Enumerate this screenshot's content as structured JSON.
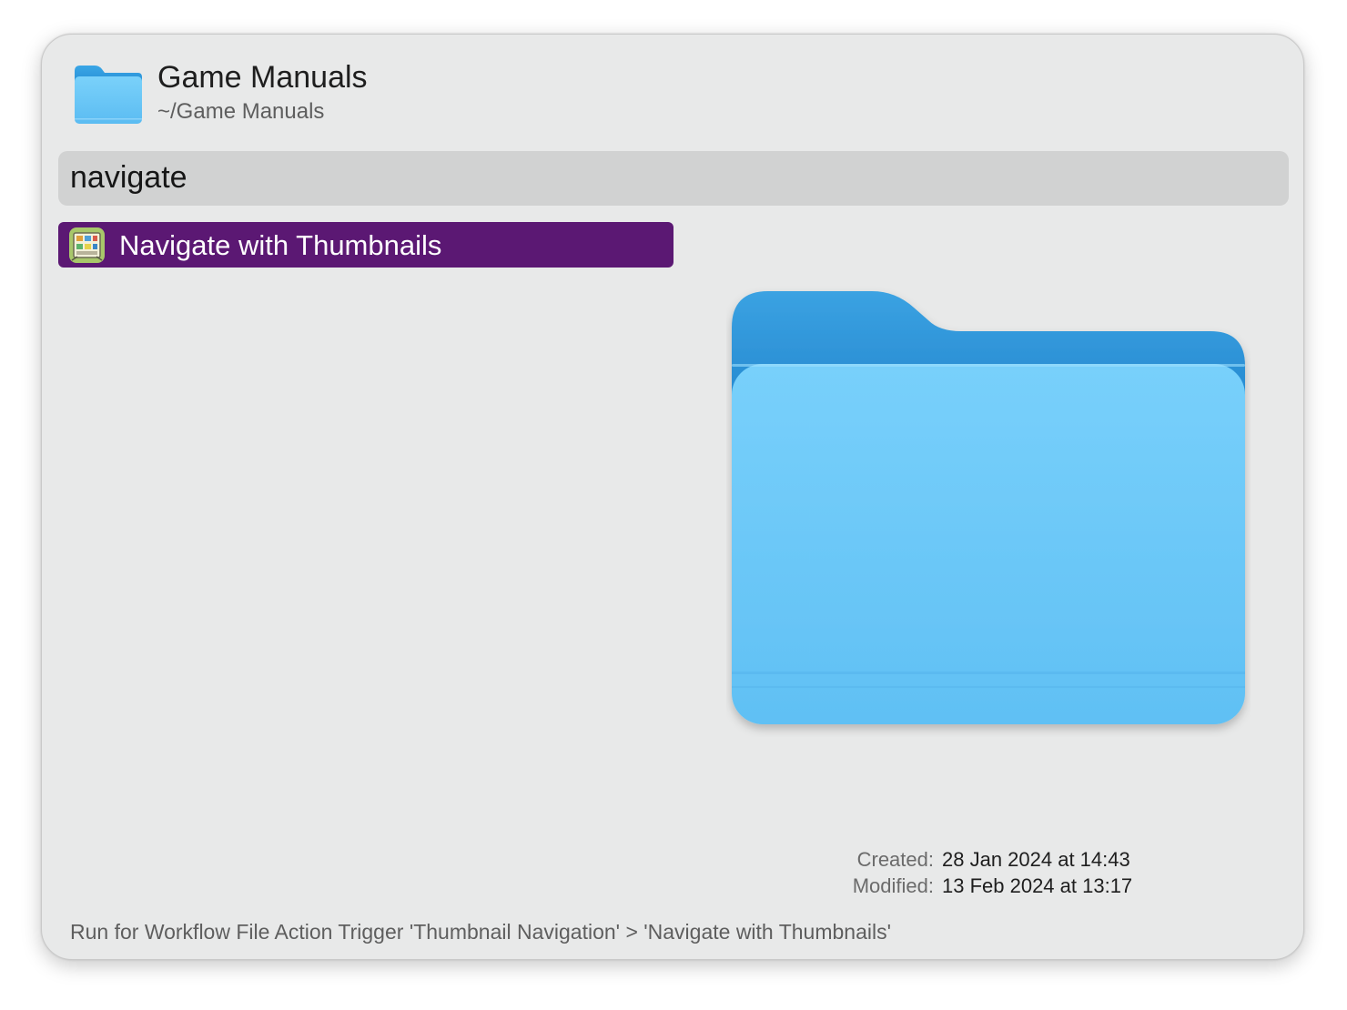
{
  "header": {
    "icon": "folder-icon",
    "title": "Game Manuals",
    "path": "~/Game Manuals"
  },
  "search": {
    "query": "navigate"
  },
  "results": [
    {
      "label": "Navigate with Thumbnails",
      "icon": "thumbnail-grid-icon",
      "selected": true
    }
  ],
  "preview": {
    "icon": "folder-icon"
  },
  "metadata": {
    "created_label": "Created:",
    "created_value": "28 Jan 2024 at 14:43",
    "modified_label": "Modified:",
    "modified_value": "13 Feb 2024 at 13:17"
  },
  "footer": {
    "text": "Run for Workflow File Action Trigger 'Thumbnail Navigation' > 'Navigate with Thumbnails'"
  },
  "colors": {
    "selection": "#5b1873",
    "folder_front": "#6fcaf8",
    "folder_back": "#2a94d6"
  }
}
